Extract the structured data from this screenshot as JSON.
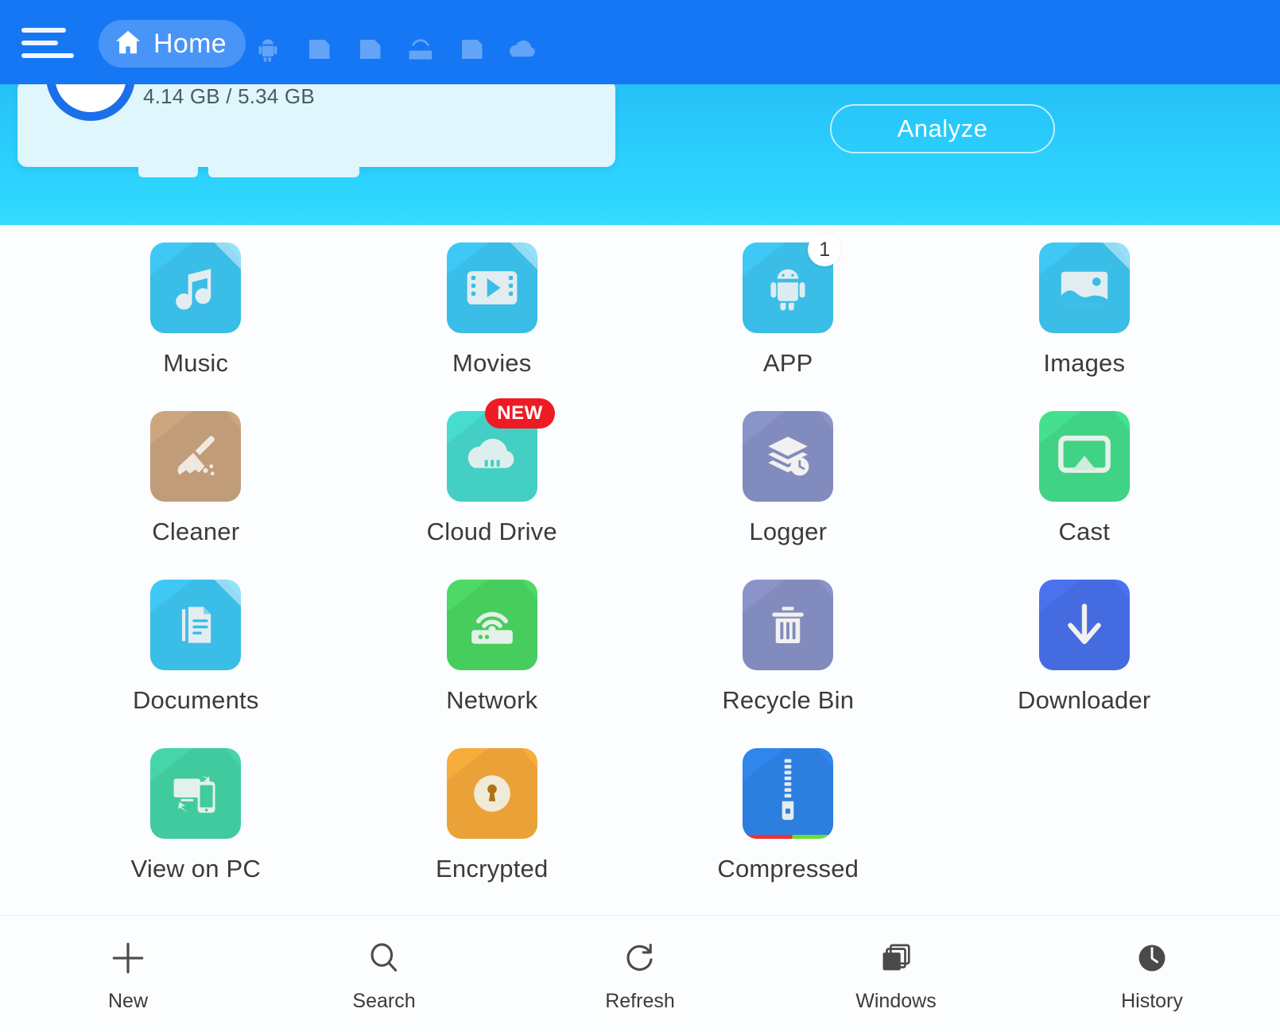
{
  "topbar": {
    "menu_icon": "hamburger-menu-icon",
    "home_label": "Home",
    "home_icon": "home-icon",
    "tabs": [
      {
        "name": "android-tab-icon"
      },
      {
        "name": "storage-tab-icon"
      },
      {
        "name": "sdcard-tab-icon"
      },
      {
        "name": "lan-tab-icon"
      },
      {
        "name": "storage2-tab-icon"
      },
      {
        "name": "cloud-tab-icon"
      }
    ]
  },
  "header": {
    "storage_text": "4.14 GB / 5.34 GB",
    "analyze_label": "Analyze",
    "accent_blue": "#1677f5",
    "header_gradient_from": "#21aef4",
    "header_gradient_to": "#38dcff"
  },
  "grid": {
    "tiles": [
      {
        "label": "Music",
        "icon": "music-note-icon",
        "color": "#3ec8f5",
        "badge": null,
        "badge_type": null
      },
      {
        "label": "Movies",
        "icon": "film-play-icon",
        "color": "#3ec8f5",
        "badge": null,
        "badge_type": null
      },
      {
        "label": "APP",
        "icon": "android-robot-icon",
        "color": "#3ec8f5",
        "badge": "1",
        "badge_type": "count"
      },
      {
        "label": "Images",
        "icon": "picture-icon",
        "color": "#3ec8f5",
        "badge": null,
        "badge_type": null
      },
      {
        "label": "Cleaner",
        "icon": "broom-icon",
        "color": "#cda680",
        "badge": null,
        "badge_type": null
      },
      {
        "label": "Cloud Drive",
        "icon": "cloud-icon",
        "color": "#48dbd0",
        "badge": "NEW",
        "badge_type": "new"
      },
      {
        "label": "Logger",
        "icon": "layers-clock-icon",
        "color": "#8a94c8",
        "badge": null,
        "badge_type": null
      },
      {
        "label": "Cast",
        "icon": "screen-cast-icon",
        "color": "#44e08d",
        "badge": null,
        "badge_type": null
      },
      {
        "label": "Documents",
        "icon": "document-lines-icon",
        "color": "#3ec8f5",
        "badge": null,
        "badge_type": null
      },
      {
        "label": "Network",
        "icon": "router-wifi-icon",
        "color": "#4cd964",
        "badge": null,
        "badge_type": null
      },
      {
        "label": "Recycle Bin",
        "icon": "trash-can-icon",
        "color": "#8a94c8",
        "badge": null,
        "badge_type": null
      },
      {
        "label": "Downloader",
        "icon": "download-arrow-icon",
        "color": "#4a72ef",
        "badge": null,
        "badge_type": null
      },
      {
        "label": "View on PC",
        "icon": "monitor-phone-icon",
        "color": "#45d6a8",
        "badge": null,
        "badge_type": null
      },
      {
        "label": "Encrypted",
        "icon": "lock-circle-icon",
        "color": "#f8ac3c",
        "badge": null,
        "badge_type": null
      },
      {
        "label": "Compressed",
        "icon": "zipper-icon",
        "color": "#2f86ec",
        "badge": null,
        "badge_type": null
      }
    ]
  },
  "bottombar": {
    "items": [
      {
        "label": "New",
        "icon": "plus-icon"
      },
      {
        "label": "Search",
        "icon": "magnifier-icon"
      },
      {
        "label": "Refresh",
        "icon": "refresh-icon"
      },
      {
        "label": "Windows",
        "icon": "windows-stack-icon"
      },
      {
        "label": "History",
        "icon": "clock-icon"
      }
    ]
  }
}
